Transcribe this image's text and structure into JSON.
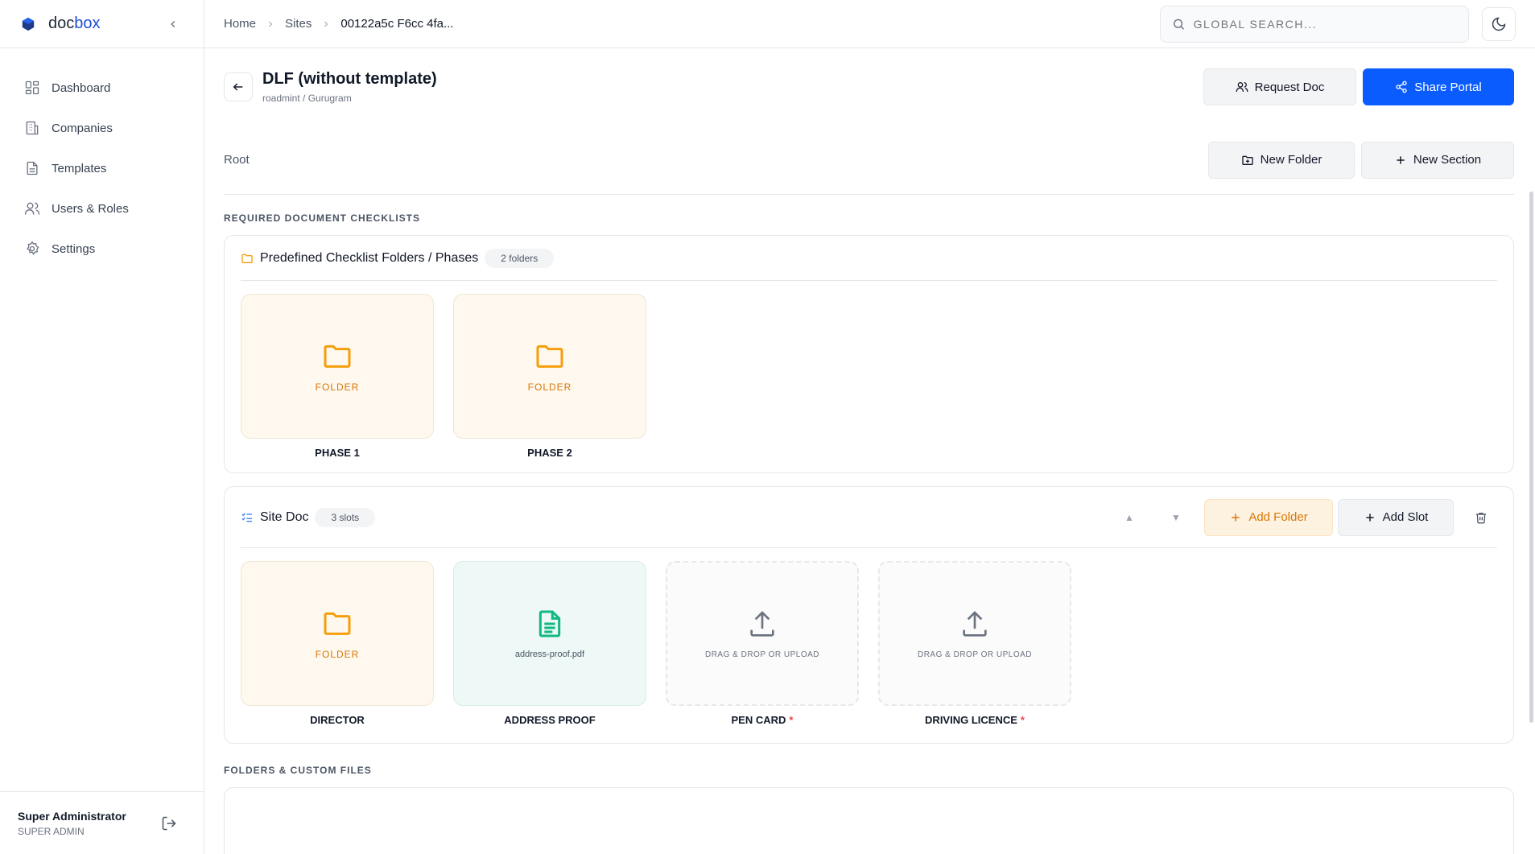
{
  "brand": {
    "name_part1": "doc",
    "name_part2": "box",
    "accent": "#1d4ed8"
  },
  "sidebar": {
    "items": [
      {
        "label": "Dashboard",
        "icon": "dashboard-icon"
      },
      {
        "label": "Companies",
        "icon": "building-icon"
      },
      {
        "label": "Templates",
        "icon": "document-icon"
      },
      {
        "label": "Users & Roles",
        "icon": "users-icon"
      },
      {
        "label": "Settings",
        "icon": "gear-icon"
      }
    ],
    "user": {
      "name": "Super Administrator",
      "role": "SUPER ADMIN"
    }
  },
  "topbar": {
    "breadcrumb": [
      "Home",
      "Sites",
      "00122a5c F6cc 4fa..."
    ],
    "search_placeholder": "GLOBAL SEARCH..."
  },
  "header": {
    "title": "DLF (without template)",
    "subtitle": "roadmint / Gurugram",
    "request_label": "Request Doc",
    "share_label": "Share Portal",
    "primary_color": "#0a5cff"
  },
  "root": {
    "label": "Root",
    "new_folder_label": "New Folder",
    "new_section_label": "New Section"
  },
  "checklists_label": "REQUIRED DOCUMENT CHECKLISTS",
  "predefined": {
    "title": "Predefined Checklist Folders / Phases",
    "count": "2 folders",
    "tiles": [
      {
        "caption": "FOLDER",
        "label": "PHASE 1"
      },
      {
        "caption": "FOLDER",
        "label": "PHASE 2"
      }
    ]
  },
  "site_doc": {
    "title": "Site Doc",
    "count": "3 slots",
    "up_glyph": "▲",
    "down_glyph": "▼",
    "add_folder_label": "Add Folder",
    "add_slot_label": "Add Slot",
    "tiles": [
      {
        "kind": "folder",
        "caption": "FOLDER",
        "label": "DIRECTOR"
      },
      {
        "kind": "file",
        "caption": "address-proof.pdf",
        "label": "ADDRESS PROOF"
      },
      {
        "kind": "upload",
        "caption": "DRAG & DROP OR UPLOAD",
        "label": "PEN CARD",
        "required": "*"
      },
      {
        "kind": "upload",
        "caption": "DRAG & DROP OR UPLOAD",
        "label": "DRIVING LICENCE",
        "required": "*"
      }
    ]
  },
  "custom_files_label": "FOLDERS & CUSTOM FILES"
}
